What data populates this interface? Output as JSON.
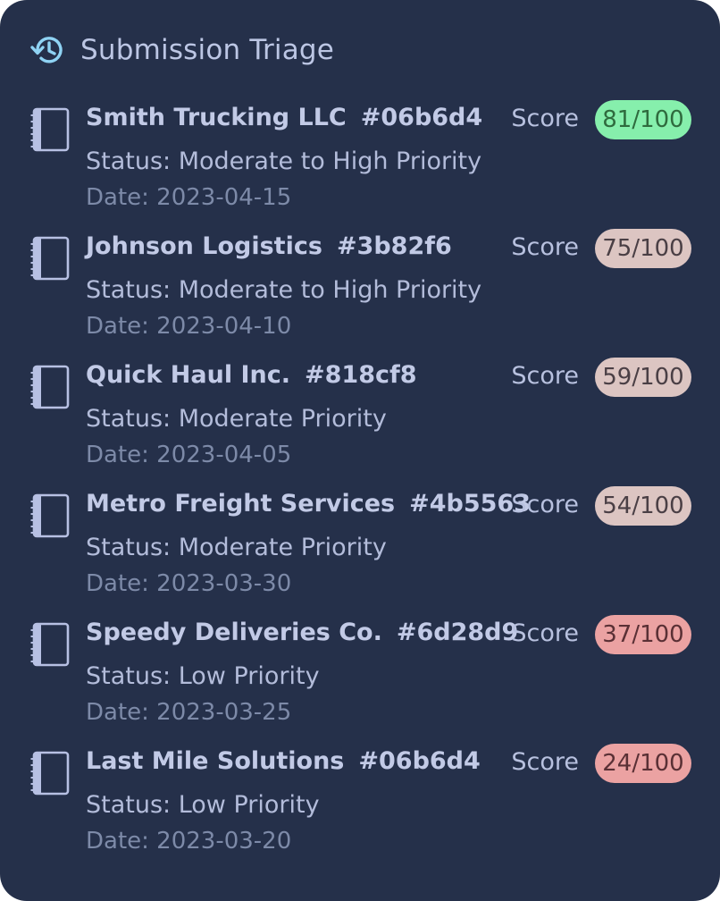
{
  "header": {
    "title": "Submission Triage",
    "icon": "history-icon"
  },
  "score_label": "Score",
  "items": [
    {
      "company": "Smith Trucking LLC",
      "code": "#06b6d4",
      "status": "Status: Moderate to High Priority",
      "date": "Date: 2023-04-15",
      "score": "81/100",
      "score_value": 81,
      "badge_color": "#86efac",
      "badge_text_color": "#2f6b3e"
    },
    {
      "company": "Johnson Logistics",
      "code": "#3b82f6",
      "status": "Status: Moderate to High Priority",
      "date": "Date: 2023-04-10",
      "score": "75/100",
      "score_value": 75,
      "badge_color": "#dcc5c2",
      "badge_text_color": "#4a3f45"
    },
    {
      "company": "Quick Haul Inc.",
      "code": "#818cf8",
      "status": "Status: Moderate Priority",
      "date": "Date: 2023-04-05",
      "score": "59/100",
      "score_value": 59,
      "badge_color": "#dcc5c2",
      "badge_text_color": "#4a3f45"
    },
    {
      "company": "Metro Freight Services",
      "code": "#4b5563",
      "status": "Status: Moderate Priority",
      "date": "Date: 2023-03-30",
      "score": "54/100",
      "score_value": 54,
      "badge_color": "#dcc5c2",
      "badge_text_color": "#4a3f45"
    },
    {
      "company": "Speedy Deliveries Co.",
      "code": "#6d28d9",
      "status": "Status: Low Priority",
      "date": "Date: 2023-03-25",
      "score": "37/100",
      "score_value": 37,
      "badge_color": "#eba2a2",
      "badge_text_color": "#5a3035"
    },
    {
      "company": "Last Mile Solutions",
      "code": "#06b6d4",
      "status": "Status: Low Priority",
      "date": "Date: 2023-03-20",
      "score": "24/100",
      "score_value": 24,
      "badge_color": "#eba2a2",
      "badge_text_color": "#5a3035"
    }
  ],
  "colors": {
    "panel_bg": "#25304a",
    "title": "#bcc6e4",
    "accent_icon": "#8fd3f4"
  }
}
